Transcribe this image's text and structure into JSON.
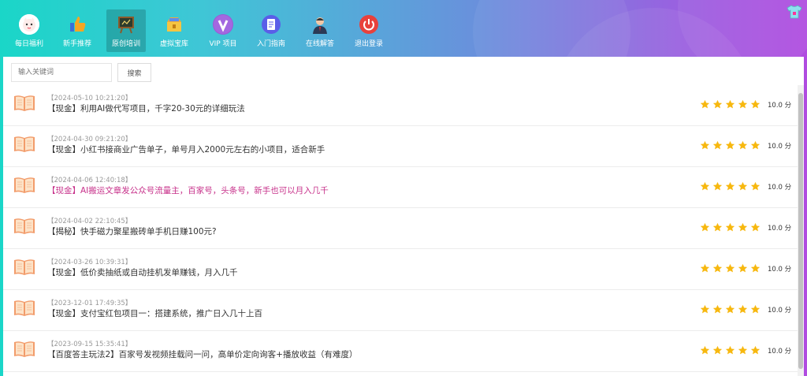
{
  "nav": {
    "items": [
      {
        "label": "每日福利",
        "icon": "lucky-cat-icon",
        "active": false
      },
      {
        "label": "新手推荐",
        "icon": "thumbs-up-icon",
        "active": false
      },
      {
        "label": "原创培训",
        "icon": "blackboard-icon",
        "active": true
      },
      {
        "label": "虚拟宝库",
        "icon": "treasure-box-icon",
        "active": false
      },
      {
        "label": "VIP 项目",
        "icon": "vip-icon",
        "active": false
      },
      {
        "label": "入门指南",
        "icon": "guide-doc-icon",
        "active": false
      },
      {
        "label": "在线解答",
        "icon": "support-person-icon",
        "active": false
      },
      {
        "label": "退出登录",
        "icon": "power-icon",
        "active": false
      }
    ]
  },
  "search": {
    "placeholder": "输入关键词",
    "button_label": "搜索"
  },
  "articles": [
    {
      "date": "【2024-05-10 10:21:20】",
      "title": "【现金】利用AI做代写项目，千字20-30元的详细玩法",
      "rating": 5,
      "score": "10.0 分",
      "highlight": false
    },
    {
      "date": "【2024-04-30 09:21:20】",
      "title": "【现金】小红书接商业广告单子，单号月入2000元左右的小项目，适合新手",
      "rating": 5,
      "score": "10.0 分",
      "highlight": false
    },
    {
      "date": "【2024-04-06 12:40:18】",
      "title": "【现金】AI搬运文章发公众号流量主，百家号，头条号，新手也可以月入几千",
      "rating": 5,
      "score": "10.0 分",
      "highlight": true
    },
    {
      "date": "【2024-04-02 22:10:45】",
      "title": "【揭秘】快手磁力聚星搬砖单手机日赚100元?",
      "rating": 5,
      "score": "10.0 分",
      "highlight": false
    },
    {
      "date": "【2024-03-26 10:39:31】",
      "title": "【现金】低价卖抽纸或自动挂机发单赚钱，月入几千",
      "rating": 5,
      "score": "10.0 分",
      "highlight": false
    },
    {
      "date": "【2023-12-01 17:49:35】",
      "title": "【现金】支付宝红包项目一：搭建系统，推广日入几十上百",
      "rating": 5,
      "score": "10.0 分",
      "highlight": false
    },
    {
      "date": "【2023-09-15 15:35:41】",
      "title": "【百度答主玩法2】百家号发视频挂载问一问，高单价定向询客+播放收益（有难度）",
      "rating": 5,
      "score": "10.0 分",
      "highlight": false
    }
  ],
  "colors": {
    "star": "#f7b80f",
    "highlight_title": "#c7308a",
    "book": "#f29c6b"
  }
}
